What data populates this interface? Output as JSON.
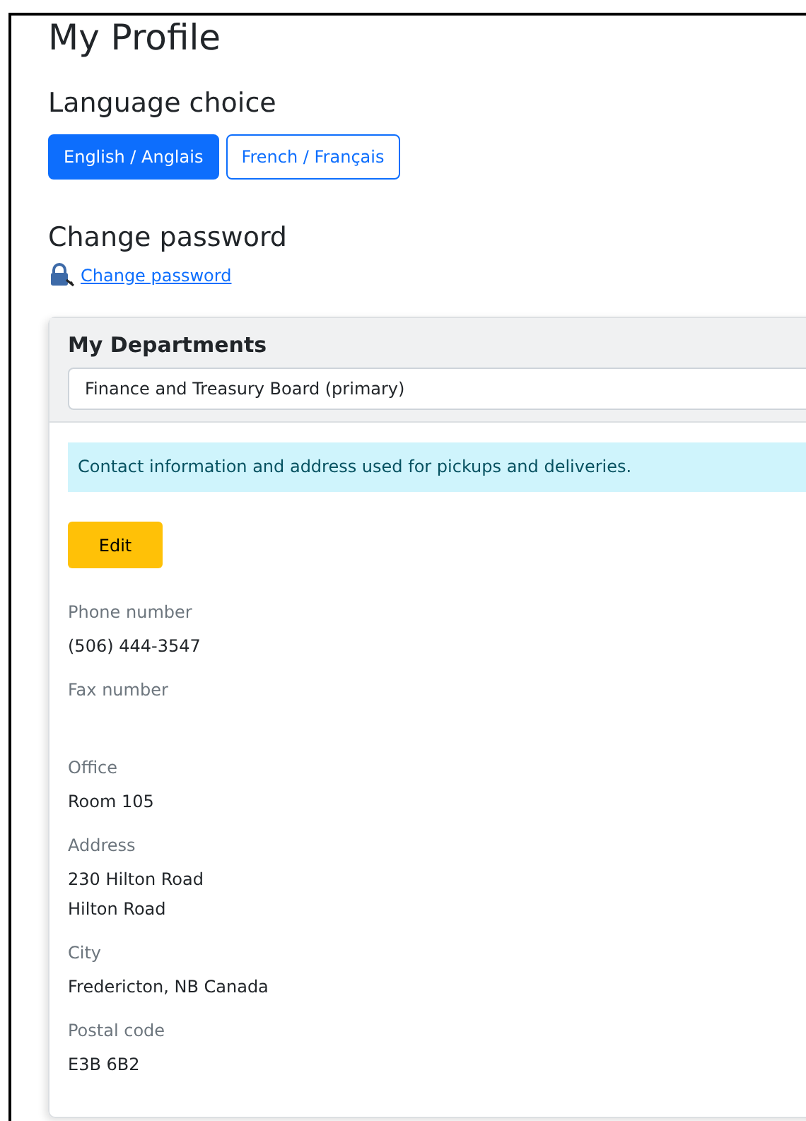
{
  "title": "My Profile",
  "language": {
    "heading": "Language choice",
    "options": [
      {
        "label": "English / Anglais",
        "selected": true
      },
      {
        "label": "French / Français",
        "selected": false
      }
    ]
  },
  "password": {
    "heading": "Change password",
    "link": "Change password"
  },
  "departments": {
    "heading": "My Departments",
    "select": {
      "value": "Finance and Treasury Board (primary)"
    },
    "notice": "Contact information and address used for pickups and deliveries.",
    "edit_button": "Edit",
    "fields": [
      {
        "label": "Phone number",
        "lines": [
          "(506) 444-3547"
        ]
      },
      {
        "label": "Fax number"
      },
      {
        "label": "Office",
        "lines": [
          "Room 105"
        ]
      },
      {
        "label": "Address",
        "lines": [
          "230 Hilton Road",
          "Hilton Road"
        ]
      },
      {
        "label": "City",
        "lines": [
          "Fredericton, NB Canada"
        ]
      },
      {
        "label": "Postal code",
        "lines": [
          "E3B 6B2"
        ]
      }
    ]
  }
}
